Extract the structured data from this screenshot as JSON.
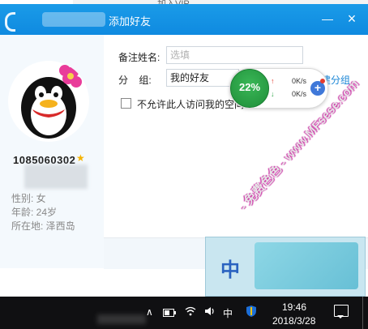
{
  "background_window": {
    "text": "加入VIP"
  },
  "dialog": {
    "title": "添加好友",
    "minimize_symbol": "—",
    "close_symbol": "×"
  },
  "profile": {
    "qq_number": "1085060302",
    "vip_star": "★",
    "gender": "性别: 女",
    "age": "年龄: 24岁",
    "location": "所在地: 泽西岛"
  },
  "form": {
    "remark_label": "备注姓名:",
    "remark_placeholder": "选填",
    "group_label": "分    组:",
    "group_value": "我的好友",
    "new_group_link": "新建分组",
    "privacy_label": "不允许此人访问我的空间"
  },
  "speed_widget": {
    "percent": "22%",
    "up_arrow": "↑",
    "down_arrow": "↓",
    "upload": "0K/s",
    "download": "0K/s",
    "plus": "+"
  },
  "ime_popup": {
    "char": "中"
  },
  "watermark": "- 免费色色 - www.MFsese.com",
  "taskbar": {
    "time": "19:46",
    "date": "2018/3/28",
    "ime_indicator": "中",
    "tray_chevron": "∧"
  },
  "colors": {
    "titlebar": "#1a9be8",
    "link": "#1a86d6",
    "speed_green": "#2ea84a",
    "taskbar": "#101012"
  }
}
